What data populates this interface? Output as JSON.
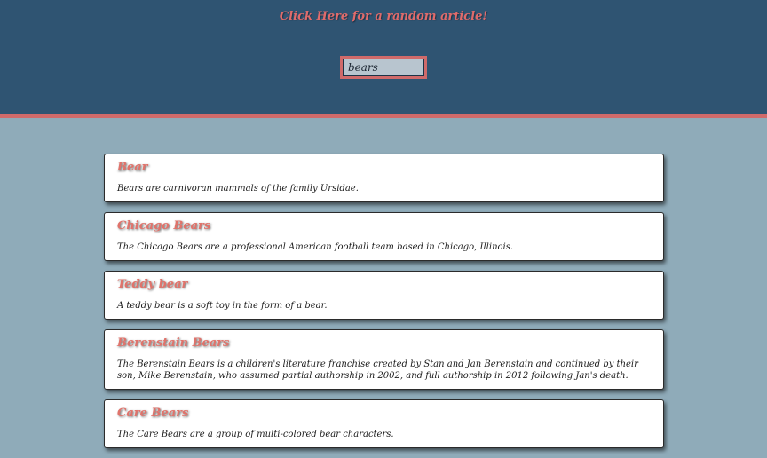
{
  "header": {
    "random_link": "Click Here for a random article!",
    "search_value": "bears"
  },
  "results": [
    {
      "title": "Bear",
      "snippet": "Bears are carnivoran mammals of the family Ursidae."
    },
    {
      "title": "Chicago Bears",
      "snippet": "The Chicago Bears are a professional American football team based in Chicago, Illinois."
    },
    {
      "title": "Teddy bear",
      "snippet": "A teddy bear is a soft toy in the form of a bear."
    },
    {
      "title": "Berenstain Bears",
      "snippet": "The Berenstain Bears is a children's literature franchise created by Stan and Jan Berenstain and continued by their son, Mike Berenstain, who assumed partial authorship in 2002, and full authorship in 2012 following Jan's death."
    },
    {
      "title": "Care Bears",
      "snippet": "The Care Bears are a group of multi-colored bear characters."
    }
  ]
}
